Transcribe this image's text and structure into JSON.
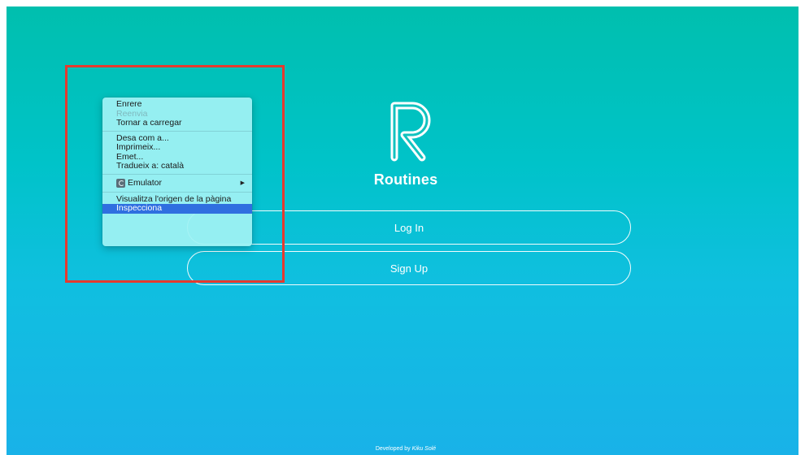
{
  "app": {
    "title": "Routines",
    "logo_icon": "routines-r-logo",
    "login_label": "Log In",
    "signup_label": "Sign Up",
    "footer_prefix": "Developed by ",
    "footer_author": "Kiku Solé"
  },
  "context_menu": {
    "groups": [
      [
        {
          "label": "Enrere",
          "state": "enabled"
        },
        {
          "label": "Reenvia",
          "state": "disabled"
        },
        {
          "label": "Tornar a carregar",
          "state": "enabled"
        }
      ],
      [
        {
          "label": "Desa com a...",
          "state": "enabled"
        },
        {
          "label": "Imprimeix...",
          "state": "enabled"
        },
        {
          "label": "Emet...",
          "state": "enabled"
        },
        {
          "label": "Tradueix a: català",
          "state": "enabled"
        }
      ],
      [
        {
          "label": "Emulator",
          "state": "enabled",
          "icon": "emulator-extension-icon",
          "submenu": true
        }
      ],
      [
        {
          "label": "Visualitza l'origen de la pàgina",
          "state": "enabled"
        },
        {
          "label": "Inspecciona",
          "state": "selected"
        }
      ]
    ]
  },
  "colors": {
    "gradient_top": "#00bfae",
    "gradient_bottom": "#19b2e8",
    "highlight_border": "#e53a2f",
    "menu_selected": "#2f6fe0"
  }
}
